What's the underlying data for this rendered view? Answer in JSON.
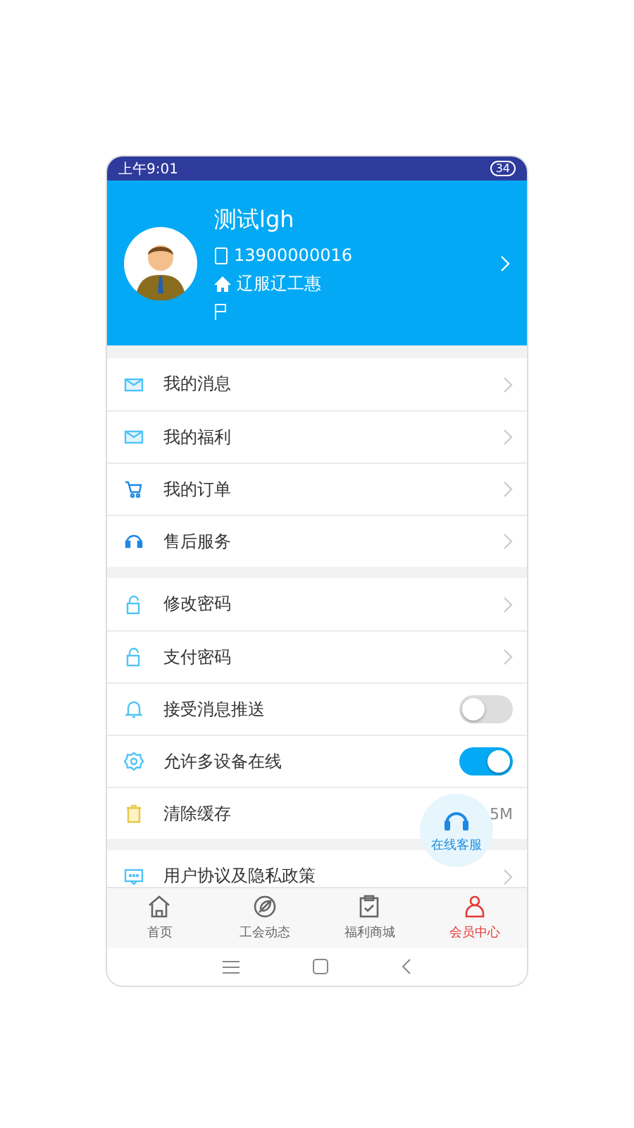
{
  "status_bar": {
    "time": "上午9:01",
    "battery": "34"
  },
  "profile": {
    "name": "测试lgh",
    "phone": "13900000016",
    "organization": "辽服辽工惠"
  },
  "menu_groups": [
    {
      "items": [
        {
          "kind": "link",
          "label": "我的消息"
        },
        {
          "kind": "link",
          "label": "我的福利"
        },
        {
          "kind": "link",
          "label": "我的订单"
        },
        {
          "kind": "link",
          "label": "售后服务"
        }
      ]
    },
    {
      "items": [
        {
          "kind": "link",
          "label": "修改密码"
        },
        {
          "kind": "link",
          "label": "支付密码"
        },
        {
          "kind": "toggle",
          "label": "接受消息推送",
          "on": false
        },
        {
          "kind": "toggle",
          "label": "允许多设备在线",
          "on": true
        },
        {
          "kind": "value",
          "label": "清除缓存",
          "value": "5M"
        }
      ]
    },
    {
      "items": [
        {
          "kind": "link",
          "label": "用户协议及隐私政策"
        }
      ]
    }
  ],
  "float_button": {
    "label": "在线客服"
  },
  "tabs": [
    {
      "label": "首页",
      "selected": false
    },
    {
      "label": "工会动态",
      "selected": false
    },
    {
      "label": "福利商城",
      "selected": false
    },
    {
      "label": "会员中心",
      "selected": true
    }
  ]
}
